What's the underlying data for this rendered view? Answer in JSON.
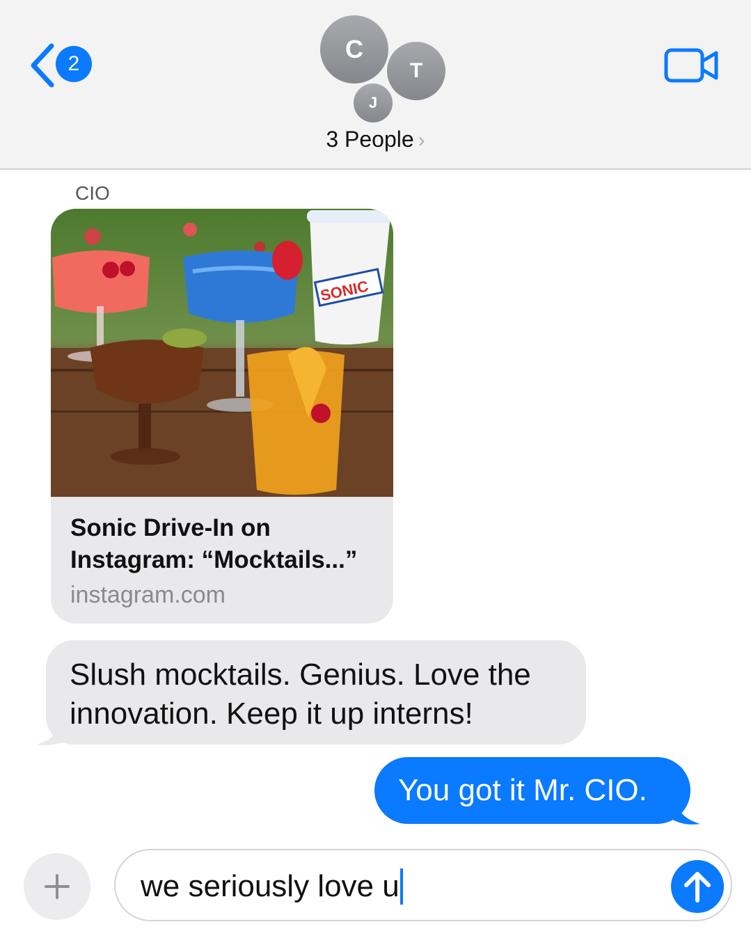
{
  "header": {
    "back_badge": "2",
    "avatars": [
      "C",
      "T",
      "J"
    ],
    "group_label": "3 People",
    "chevron": "›",
    "icons": {
      "back": "chevron-left-icon",
      "video": "video-camera-icon"
    },
    "accent_color": "#0a7aff"
  },
  "messages": [
    {
      "type": "link",
      "sender": "CIO",
      "title": "Sonic Drive-In on Instagram: “Mocktails...”",
      "domain": "instagram.com",
      "image_text": "SONIC"
    },
    {
      "type": "incoming",
      "text": "Slush mocktails. Genius. Love the innovation. Keep it up interns!"
    },
    {
      "type": "outgoing",
      "text": "You got it Mr. CIO."
    }
  ],
  "composer": {
    "value": "we seriously love u",
    "icons": {
      "plus": "plus-icon",
      "send": "arrow-up-icon"
    }
  }
}
